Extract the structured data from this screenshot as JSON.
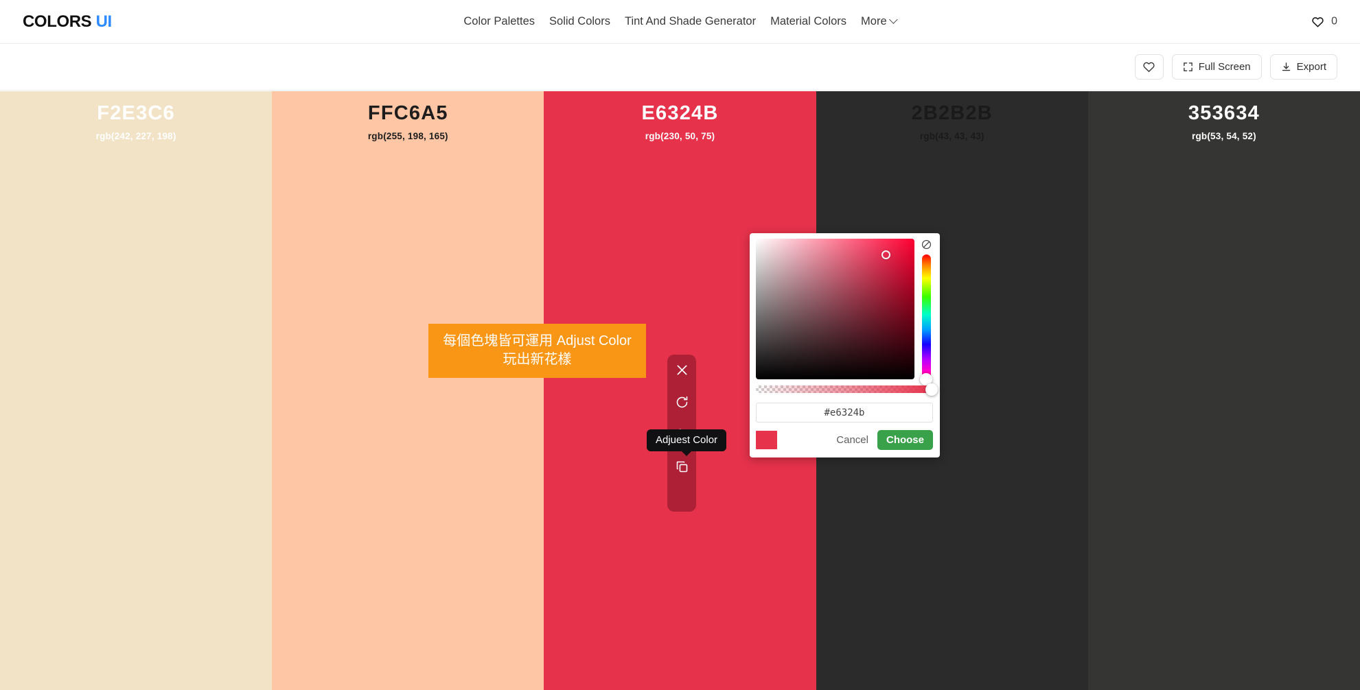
{
  "header": {
    "logo_primary": "COLORS",
    "logo_accent": "UI",
    "nav": [
      {
        "label": "Color Palettes"
      },
      {
        "label": "Solid Colors"
      },
      {
        "label": "Tint And Shade Generator"
      },
      {
        "label": "Material Colors"
      },
      {
        "label": "More"
      }
    ],
    "favorites_count": "0",
    "heart_icon": "heart-icon",
    "chevron_icon": "chevron-down-icon",
    "accent_color": "#2e8bff"
  },
  "toolbar": {
    "favorite_label": "",
    "favorite_icon": "heart-icon",
    "fullscreen_label": "Full Screen",
    "fullscreen_icon": "expand-icon",
    "export_label": "Export",
    "export_icon": "download-icon"
  },
  "palette": {
    "swatches": [
      {
        "hex": "F2E3C6",
        "rgb": "rgb(242, 227, 198)",
        "bg": "#f2e3c6",
        "text": "#ffffff"
      },
      {
        "hex": "FFC6A5",
        "rgb": "rgb(255, 198, 165)",
        "bg": "#ffc6a5",
        "text": "#1d1d1d"
      },
      {
        "hex": "E6324B",
        "rgb": "rgb(230, 50, 75)",
        "bg": "#e6324b",
        "text": "#ffffff"
      },
      {
        "hex": "2B2B2B",
        "rgb": "rgb(43, 43, 43)",
        "bg": "#2b2b2b",
        "text": "#1a1a1a"
      },
      {
        "hex": "353634",
        "rgb": "rgb(53, 54, 52)",
        "bg": "#353634",
        "text": "#ffffff"
      }
    ]
  },
  "annotation": {
    "line1": "每個色塊皆可運用 Adjust Color",
    "line2": "玩出新花樣",
    "bg": "#fa9616",
    "color": "#ffffff"
  },
  "actionbar": {
    "items": [
      {
        "name": "close-icon",
        "label": "Close"
      },
      {
        "name": "refresh-icon",
        "label": "Refresh"
      },
      {
        "name": "adjust-icon",
        "label": "Adjust Color"
      },
      {
        "name": "copy-icon",
        "label": "Copy"
      }
    ]
  },
  "tooltip": {
    "text": "Adjuest Color"
  },
  "picker": {
    "hex_value": "#e6324b",
    "hex_placeholder": "#e6324b",
    "preview_color": "#e6324b",
    "cancel_label": "Cancel",
    "choose_label": "Choose",
    "choose_color": "#3aa14b",
    "no_color_icon": "no-color-icon",
    "sv_handle_name": "saturation-handle",
    "hue_handle_name": "hue-handle",
    "alpha_handle_name": "alpha-handle"
  }
}
